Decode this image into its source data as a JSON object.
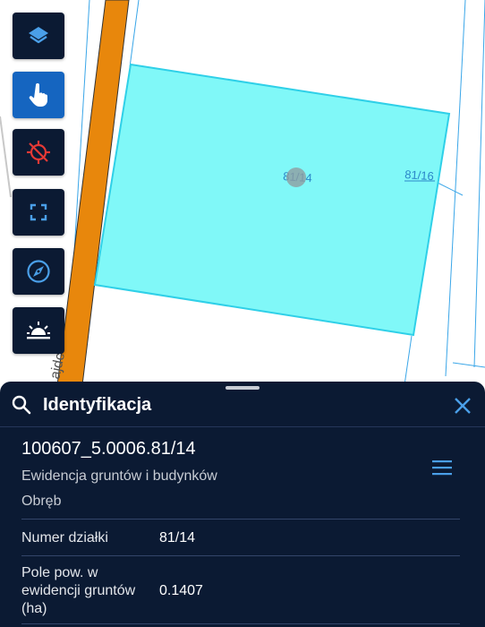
{
  "map": {
    "road_label": "ajdc",
    "parcel_label": "81/14",
    "neighbor_label": "81/16",
    "colors": {
      "parcel_fill": "#80f8f8",
      "parcel_stroke": "#2fd0e8",
      "road": "#e8870c",
      "boundary": "#3aa6e8"
    }
  },
  "toolbar": {
    "items": [
      {
        "name": "layers-button",
        "icon": "layers-icon",
        "active": false
      },
      {
        "name": "identify-button",
        "icon": "tap-hand-icon",
        "active": true
      },
      {
        "name": "gps-location-button",
        "icon": "gps-off-icon",
        "active": false
      },
      {
        "name": "fullscreen-button",
        "icon": "fullscreen-icon",
        "active": false
      },
      {
        "name": "compass-button",
        "icon": "compass-icon",
        "active": false
      },
      {
        "name": "daylight-button",
        "icon": "sunrise-icon",
        "active": false
      }
    ]
  },
  "panel": {
    "title": "Identyfikacja",
    "parcel_id": "100607_5.0006.81/14",
    "layer_name": "Ewidencja gruntów i budynków",
    "category": "Obręb",
    "rows": [
      {
        "label": "Numer działki",
        "value": "81/14"
      },
      {
        "label": "Pole pow. w ewidencji gruntów (ha)",
        "value": "0.1407"
      }
    ],
    "colors": {
      "background": "#0b1a33",
      "accent": "#4a9fe8"
    }
  }
}
